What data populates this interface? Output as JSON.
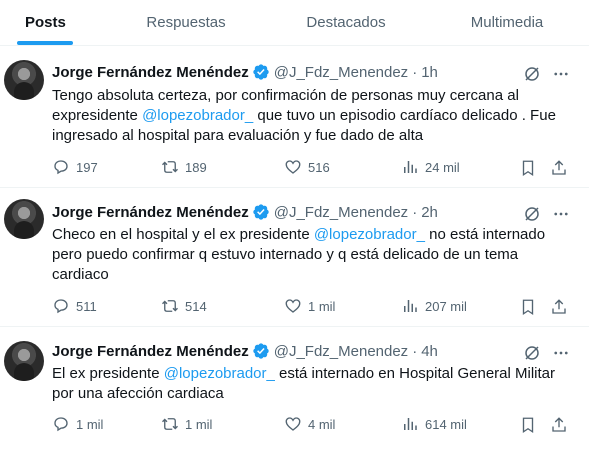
{
  "tabs": [
    {
      "label": "Posts",
      "active": true
    },
    {
      "label": "Respuestas",
      "active": false
    },
    {
      "label": "Destacados",
      "active": false
    },
    {
      "label": "Multimedia",
      "active": false
    }
  ],
  "author": {
    "name": "Jorge Fernández Menéndez",
    "handle": "@J_Fdz_Menendez"
  },
  "separator": "·",
  "tweets": [
    {
      "time": "1h",
      "text_before": "Tengo absoluta certeza, por confirmación de personas muy cercana al expresidente ",
      "mention": "@lopezobrador_",
      "text_after": " que tuvo un episodio cardíaco delicado . Fue ingresado al hospital para evaluación y fue dado de alta",
      "replies": "197",
      "reposts": "189",
      "likes": "516",
      "views": "24 mil"
    },
    {
      "time": "2h",
      "text_before": "Checo en el hospital y el ex presidente ",
      "mention": "@lopezobrador_",
      "text_after": " no está internado pero puedo confirmar q estuvo internado y q está delicado de un tema cardiaco",
      "replies": "511",
      "reposts": "514",
      "likes": "1 mil",
      "views": "207 mil"
    },
    {
      "time": "4h",
      "text_before": "El ex presidente ",
      "mention": "@lopezobrador_",
      "text_after": " está internado en Hospital General Militar por una afección cardiaca",
      "replies": "1 mil",
      "reposts": "1 mil",
      "likes": "4 mil",
      "views": "614 mil"
    }
  ],
  "colors": {
    "accent": "#1d9bf0",
    "secondary_text": "#536471",
    "primary_text": "#0f1419",
    "divider": "#eff3f4"
  },
  "icons": [
    "verified-badge-icon",
    "grok-icon",
    "more-icon",
    "reply-icon",
    "repost-icon",
    "like-icon",
    "views-icon",
    "bookmark-icon",
    "share-icon"
  ]
}
